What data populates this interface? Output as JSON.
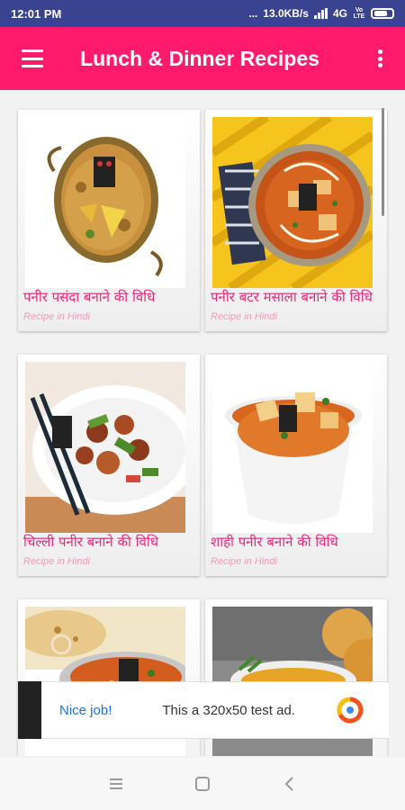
{
  "status_bar": {
    "time": "12:01 PM",
    "dots": "...",
    "network_speed": "13.0KB/s",
    "network_type": "4G",
    "volte": "Vo LTE"
  },
  "app_bar": {
    "title": "Lunch & Dinner Recipes",
    "menu_icon": "hamburger-menu-icon",
    "more_icon": "more-vertical-icon"
  },
  "recipes": [
    {
      "title": "पनीर पसंदा बनाने की विधि",
      "subtitle": "Recipe in Hindi"
    },
    {
      "title": "पनीर बटर मसाला बनाने की विधि",
      "subtitle": "Recipe in Hindi"
    },
    {
      "title": "चिल्ली पनीर बनाने की विधि",
      "subtitle": "Recipe in Hindi"
    },
    {
      "title": "शाही पनीर बनाने की विधि",
      "subtitle": "Recipe in Hindi"
    },
    {
      "title": "",
      "subtitle": ""
    },
    {
      "title": "",
      "subtitle": ""
    }
  ],
  "ad": {
    "nice_job": "Nice job!",
    "text": "This a 320x50 test ad."
  },
  "colors": {
    "status_bar": "#3a4390",
    "app_bar": "#ff1a6c",
    "recipe_title": "#e3297a",
    "recipe_subtitle": "#f29bbd"
  }
}
